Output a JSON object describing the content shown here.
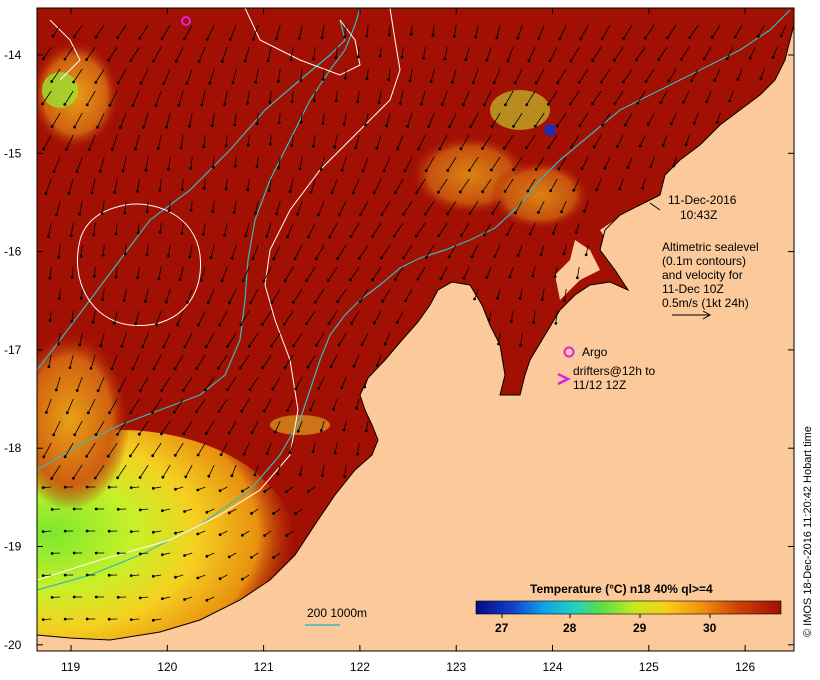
{
  "map": {
    "date_line": "11-Dec-2016",
    "time_line": "10:43Z",
    "altimetry_lines": [
      "Altimetric sealevel",
      "(0.1m contours)",
      "and velocity for",
      "11-Dec 10Z",
      "0.5m/s (1kt 24h)"
    ],
    "argo_label": "Argo",
    "drifters_line1": "drifters@12h to",
    "drifters_line2": "11/12 12Z",
    "depth_label": "200  1000m",
    "colorbar_title": "Temperature (°C) n18 40% ql>=4",
    "colorbar_ticks": [
      "27",
      "28",
      "29",
      "30"
    ],
    "x_ticks": [
      "119",
      "120",
      "121",
      "122",
      "123",
      "124",
      "125",
      "126"
    ],
    "y_ticks": [
      "-14",
      "-15",
      "-16",
      "-17",
      "-18",
      "-19",
      "-20"
    ],
    "credit": "© IMOS 18-Dec-2016 11:20:42 Hobart time"
  },
  "colors": {
    "land": "#FBC99A",
    "warm_water": "#A11003",
    "orange": "#E07A0C",
    "yellow": "#F0D020",
    "green": "#8BE02A",
    "cyan_contour": "#3BB8B8",
    "argo": "#E020E0"
  }
}
